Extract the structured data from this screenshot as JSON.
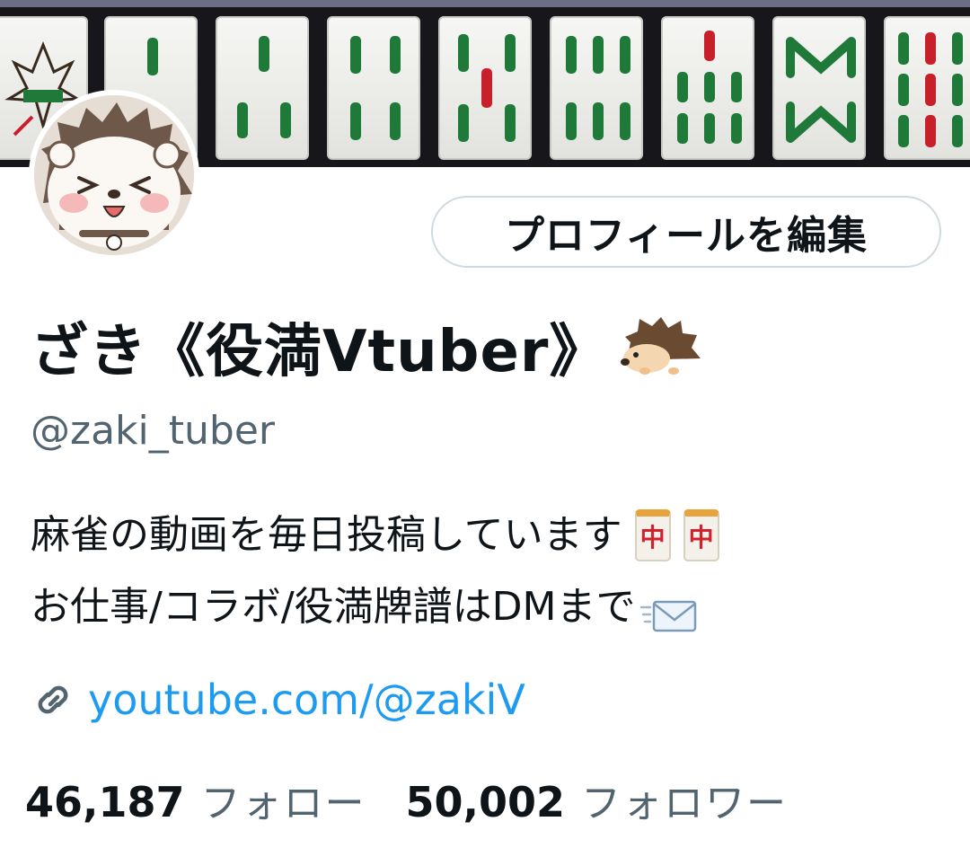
{
  "profile": {
    "edit_button": "プロフィールを編集",
    "display_name": "ざき《役満Vtuber》",
    "handle": "@zaki_tuber",
    "bio_line1": "麻雀の動画を毎日投稿しています",
    "bio_line2": "お仕事/コラボ/役満牌譜はDMまで",
    "tile_glyph": "中",
    "link": "youtube.com/@zakiV",
    "following_count": "46,187",
    "following_label": "フォロー",
    "followers_count": "50,002",
    "followers_label": "フォロワー"
  },
  "icons": {
    "name_emoji": "hedgehog-icon",
    "bio_emoji_1": "mahjong-red-dragon-icon",
    "bio_emoji_2": "envelope-icon",
    "link": "link-icon"
  },
  "colors": {
    "accent_link": "#1d9bf0",
    "secondary_text": "#536471",
    "primary_text": "#0f1419",
    "tile_green": "#1f7a3a",
    "tile_red": "#c8202a"
  }
}
